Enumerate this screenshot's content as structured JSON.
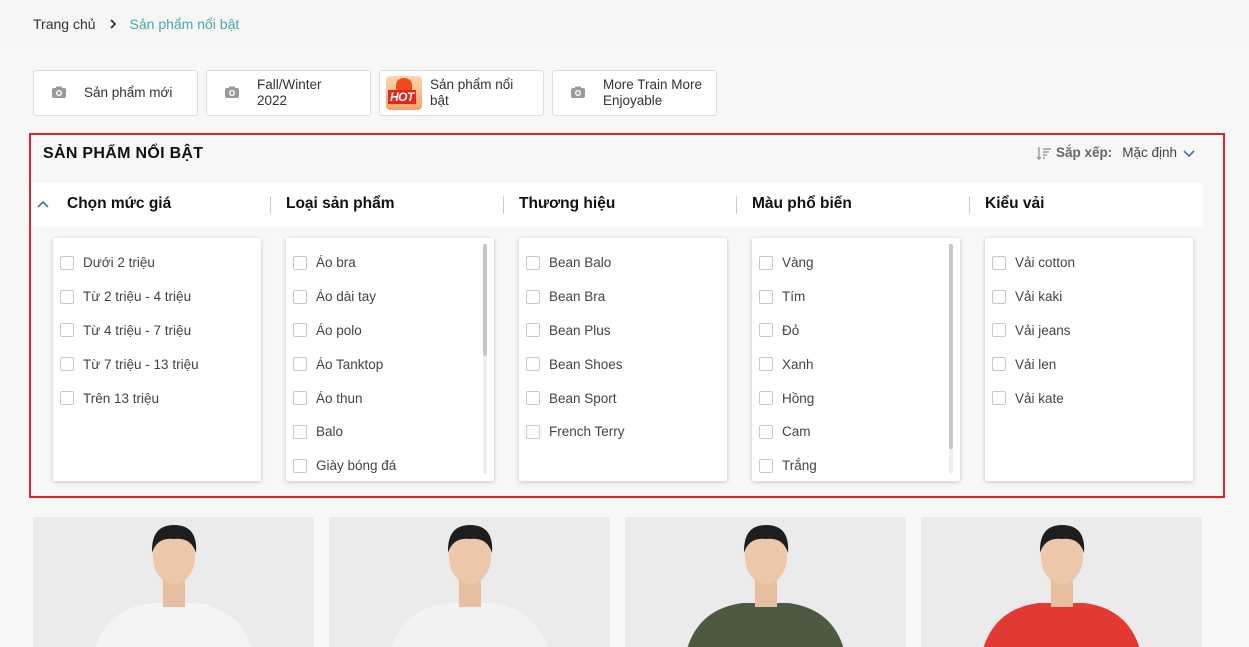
{
  "breadcrumb": {
    "home": "Trang chủ",
    "current": "Sản phẩm nổi bật"
  },
  "categories": [
    {
      "label": "Sản phẩm mới",
      "icon": "camera-icon"
    },
    {
      "label": "Fall/Winter 2022",
      "icon": "camera-icon"
    },
    {
      "label": "Sản phẩm nổi bật",
      "icon": "hot-badge-icon",
      "badge": "HOT"
    },
    {
      "label": "More Train More Enjoyable",
      "icon": "camera-icon"
    }
  ],
  "panel": {
    "title": "SẢN PHẨM NỔI BẬT",
    "sort_label": "Sắp xếp:",
    "sort_value": "Mặc định"
  },
  "filters": [
    {
      "title": "Chọn mức giá",
      "options": [
        "Dưới 2 triệu",
        "Từ 2 triệu - 4 triệu",
        "Từ 4 triệu - 7 triệu",
        "Từ 7 triệu - 13 triệu",
        "Trên 13 triệu"
      ]
    },
    {
      "title": "Loại sản phẩm",
      "options": [
        "Áo bra",
        "Áo dài tay",
        "Áo polo",
        "Áo Tanktop",
        "Áo thun",
        "Balo",
        "Giày bóng đá"
      ]
    },
    {
      "title": "Thương hiệu",
      "options": [
        "Bean Balo",
        "Bean Bra",
        "Bean Plus",
        "Bean Shoes",
        "Bean Sport",
        "French Terry"
      ]
    },
    {
      "title": "Màu phổ biến",
      "options": [
        "Vàng",
        "Tím",
        "Đỏ",
        "Xanh",
        "Hồng",
        "Cam",
        "Trắng"
      ]
    },
    {
      "title": "Kiểu vải",
      "options": [
        "Vải cotton",
        "Vải kaki",
        "Vải jeans",
        "Vải len",
        "Vải kate"
      ]
    }
  ],
  "products": [
    {
      "shirt_color": "#f4f4f4"
    },
    {
      "shirt_color": "#f2f2f2"
    },
    {
      "shirt_color": "#4d5a41"
    },
    {
      "shirt_color": "#e23a32"
    }
  ],
  "colors": {
    "accent": "#4aa9a6",
    "highlight_border": "#d7262d"
  }
}
